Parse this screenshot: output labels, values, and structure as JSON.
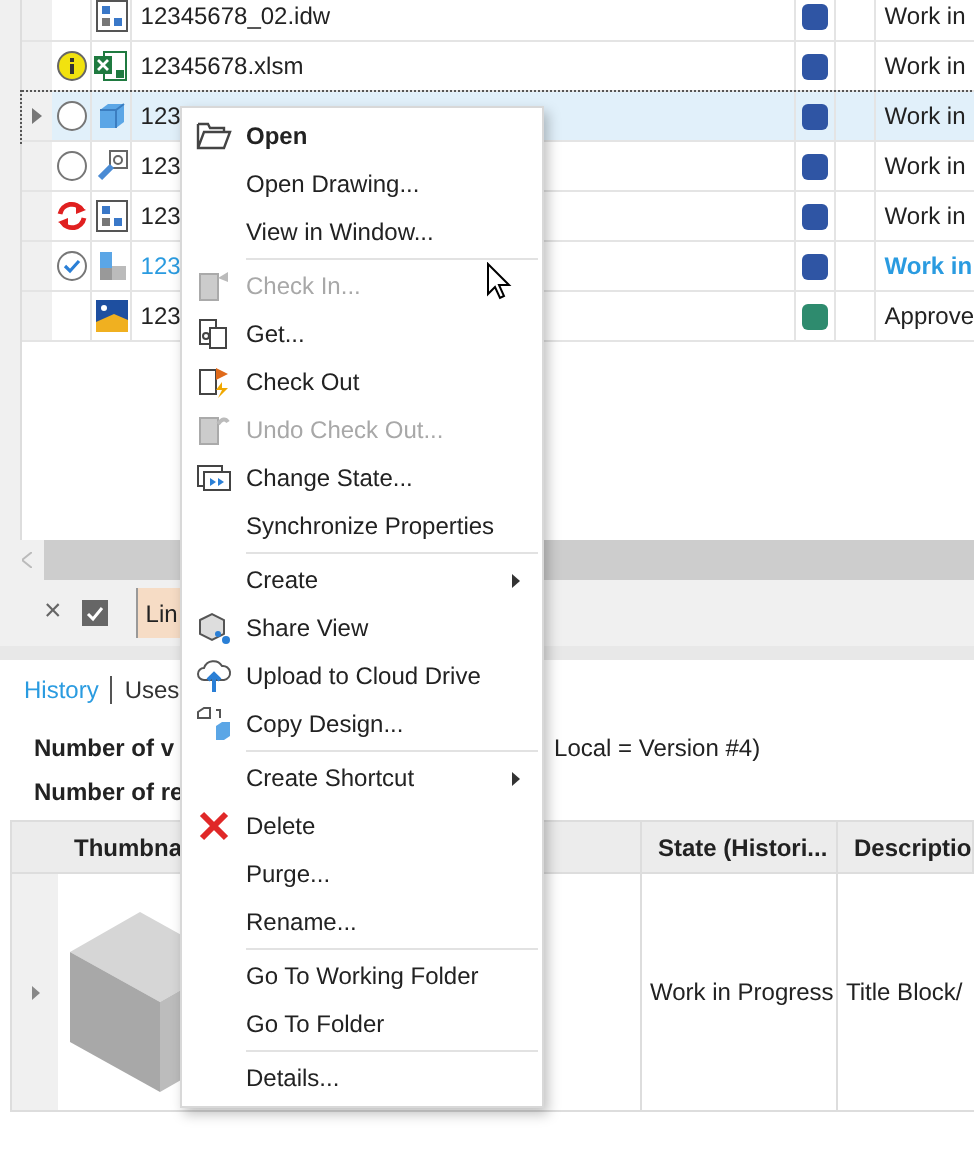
{
  "files": [
    {
      "name": "12345678_02.idw",
      "color": "#2f55a4",
      "state": "Work in",
      "selected": false,
      "emphasized": false
    },
    {
      "name": "12345678.xlsm",
      "color": "#2f55a4",
      "state": "Work in",
      "selected": false,
      "emphasized": false
    },
    {
      "name": "123",
      "color": "#2f55a4",
      "state": "Work in",
      "selected": true,
      "emphasized": false
    },
    {
      "name": "123",
      "color": "#2f55a4",
      "state": "Work in",
      "selected": false,
      "emphasized": false
    },
    {
      "name": "123",
      "color": "#2f55a4",
      "state": "Work in",
      "selected": false,
      "emphasized": false
    },
    {
      "name": "123",
      "color": "#2f55a4",
      "state": "Work in",
      "selected": false,
      "emphasized": true
    },
    {
      "name": "123",
      "color": "#2e8b6e",
      "state": "Approve",
      "selected": false,
      "emphasized": false
    }
  ],
  "toolbar": {
    "close": "×",
    "tag": "Lin",
    "checked": true
  },
  "details": {
    "tabs": [
      {
        "label": "History",
        "selected": true
      },
      {
        "label": "Uses",
        "selected": false
      }
    ],
    "version_label": "Number of v",
    "version_note": "Local = Version #4)",
    "revision_label": "Number of re",
    "columns": [
      "Thumbna",
      "State (Histori...",
      "Descriptio"
    ],
    "rows": [
      {
        "state": "Work in Progress",
        "description": "Title Block/"
      }
    ]
  },
  "context_menu": [
    {
      "label": "Open",
      "bold": true,
      "disabled": false,
      "submenu": false,
      "separator_before": false
    },
    {
      "label": "Open Drawing...",
      "bold": false,
      "disabled": false,
      "submenu": false,
      "separator_before": false
    },
    {
      "label": "View in Window...",
      "bold": false,
      "disabled": false,
      "submenu": false,
      "separator_before": false
    },
    {
      "label": "Check In...",
      "bold": false,
      "disabled": true,
      "submenu": false,
      "separator_before": true
    },
    {
      "label": "Get...",
      "bold": false,
      "disabled": false,
      "submenu": false,
      "separator_before": false
    },
    {
      "label": "Check Out",
      "bold": false,
      "disabled": false,
      "submenu": false,
      "separator_before": false
    },
    {
      "label": "Undo Check Out...",
      "bold": false,
      "disabled": true,
      "submenu": false,
      "separator_before": false
    },
    {
      "label": "Change State...",
      "bold": false,
      "disabled": false,
      "submenu": false,
      "separator_before": false
    },
    {
      "label": "Synchronize Properties",
      "bold": false,
      "disabled": false,
      "submenu": false,
      "separator_before": false
    },
    {
      "label": "Create",
      "bold": false,
      "disabled": false,
      "submenu": true,
      "separator_before": true
    },
    {
      "label": "Share View",
      "bold": false,
      "disabled": false,
      "submenu": false,
      "separator_before": false
    },
    {
      "label": "Upload to Cloud Drive",
      "bold": false,
      "disabled": false,
      "submenu": false,
      "separator_before": false
    },
    {
      "label": "Copy Design...",
      "bold": false,
      "disabled": false,
      "submenu": false,
      "separator_before": false
    },
    {
      "label": "Create Shortcut",
      "bold": false,
      "disabled": false,
      "submenu": true,
      "separator_before": true
    },
    {
      "label": "Delete",
      "bold": false,
      "disabled": false,
      "submenu": false,
      "separator_before": false
    },
    {
      "label": "Purge...",
      "bold": false,
      "disabled": false,
      "submenu": false,
      "separator_before": false
    },
    {
      "label": "Rename...",
      "bold": false,
      "disabled": false,
      "submenu": false,
      "separator_before": false
    },
    {
      "label": "Go To Working Folder",
      "bold": false,
      "disabled": false,
      "submenu": false,
      "separator_before": true
    },
    {
      "label": "Go To Folder",
      "bold": false,
      "disabled": false,
      "submenu": false,
      "separator_before": false
    },
    {
      "label": "Details...",
      "bold": false,
      "disabled": false,
      "submenu": false,
      "separator_before": true
    }
  ]
}
